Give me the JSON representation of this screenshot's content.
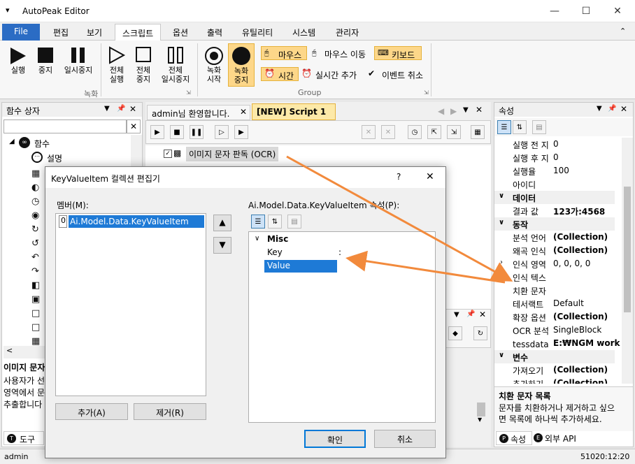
{
  "app": {
    "title": "AutoPeak Editor",
    "menu_glyph": "▾"
  },
  "tabs": [
    "File",
    "편집",
    "보기",
    "스크립트",
    "옵션",
    "출력",
    "유틸리티",
    "시스템",
    "관리자"
  ],
  "ribbon": {
    "run": "실행",
    "stop": "중지",
    "pause": "일시중지",
    "all_run": "전체\n실행",
    "all_stop": "전체\n중지",
    "all_pause": "전체\n일시중지",
    "group1": "녹화",
    "rec_start": "녹화\n시작",
    "rec_stop": "녹화\n중지",
    "mouse": "마우스",
    "mouse_move": "마우스 이동",
    "keyboard": "키보드",
    "time": "시간",
    "realtime_add": "실시간 추가",
    "event_cancel": "이벤트 취소",
    "group2": "Group"
  },
  "func_panel": {
    "title": "함수 상자",
    "root": "함수",
    "item1": "설명",
    "bottom_title": "이미지 문자",
    "bottom_desc": "사용자가 선\n영역에서 문\n추출합니다",
    "tab_tools": "도구"
  },
  "doc_tabs": {
    "tab1": "admin님 환영합니다.",
    "tab2": "[NEW] Script 1"
  },
  "script": {
    "step1": "이미지 문자 판독 (OCR)"
  },
  "props": {
    "title": "속성",
    "rows": [
      {
        "k": "실행 전 지",
        "v": "0"
      },
      {
        "k": "실행 후 지",
        "v": "0"
      },
      {
        "k": "실행율",
        "v": "100"
      },
      {
        "k": "아이디",
        "v": ""
      }
    ],
    "cat_data": "데이터",
    "result_k": "결과 값",
    "result_v": "123가:4568",
    "cat_action": "동작",
    "rows2": [
      {
        "k": "분석 언어",
        "v": "(Collection)",
        "b": true
      },
      {
        "k": "왜곡 인식",
        "v": "(Collection)",
        "b": true
      },
      {
        "k": "인식 영역",
        "v": "0, 0, 0, 0",
        "b": false
      },
      {
        "k": "인식 텍스",
        "v": "",
        "b": false
      },
      {
        "k": "치환 문자",
        "v": "",
        "b": false
      },
      {
        "k": "테서랙트",
        "v": "Default",
        "b": false
      },
      {
        "k": "확장 옵션",
        "v": "(Collection)",
        "b": true
      },
      {
        "k": "OCR 분석",
        "v": "SingleBlock",
        "b": false
      },
      {
        "k": "tessdata 폴",
        "v": "E:₩NGM work p",
        "b": true
      }
    ],
    "cat_var": "변수",
    "rows3": [
      {
        "k": "가져오기",
        "v": "(Collection)",
        "b": true
      },
      {
        "k": "추가하기",
        "v": "(Collection)",
        "b": true
      }
    ],
    "desc_title": "치환 문자 목록",
    "desc_text": "문자를 치환하거나 제거하고 싶으\n면 목록에 하나씩 추가하세요.",
    "tab_props": "속성",
    "tab_api": "외부 API"
  },
  "dialog": {
    "title": "KeyValueItem 컬렉션 편집기",
    "help": "?",
    "close": "✕",
    "members_label": "멤버(M):",
    "member_index": "0",
    "member_name": "Ai.Model.Data.KeyValueItem",
    "props_label": "Ai.Model.Data.KeyValueItem 속성(P):",
    "cat": "Misc",
    "key": "Key",
    "key_val": ":",
    "value": "Value",
    "add": "추가(A)",
    "remove": "제거(R)",
    "ok": "확인",
    "cancel": "취소"
  },
  "status": {
    "user": "admin",
    "time": "51020:12:20"
  },
  "colors": {
    "accent": "#2b6cc4",
    "highlight": "#fdd789",
    "arrow": "#f28a3c",
    "selection": "#1e7ad6"
  }
}
